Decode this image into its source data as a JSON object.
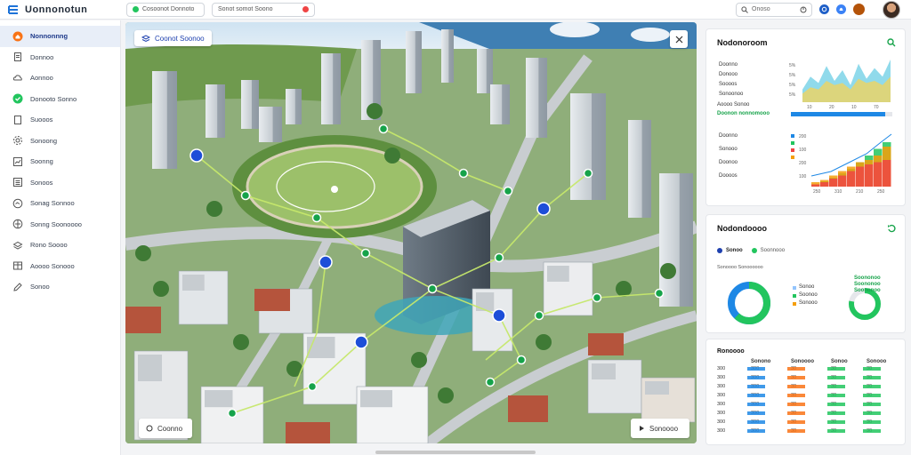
{
  "app": {
    "title": "Uonnonotun",
    "filter1": "Cosoonot Donnoto",
    "filter2": "Sonot somot Soono"
  },
  "search": {
    "value": "Onoso"
  },
  "sidebar": {
    "items": [
      {
        "label": "Nonnonnng",
        "icon": "home-icon"
      },
      {
        "label": "Donnoo",
        "icon": "doc-icon"
      },
      {
        "label": "Aonnoo",
        "icon": "cloud-icon"
      },
      {
        "label": "Donooto Sonno",
        "icon": "check-icon"
      },
      {
        "label": "Suooos",
        "icon": "page-icon"
      },
      {
        "label": "Sonoong",
        "icon": "gear-icon"
      },
      {
        "label": "Soonng",
        "icon": "chart-icon"
      },
      {
        "label": "Sonoos",
        "icon": "list-icon"
      },
      {
        "label": "Sonag Sonnoo",
        "icon": "calendar-icon"
      },
      {
        "label": "Sonng Soonoooo",
        "icon": "map-icon"
      },
      {
        "label": "Rono Soooo",
        "icon": "layers-icon"
      },
      {
        "label": "Aoooo Sonooo",
        "icon": "table-icon"
      },
      {
        "label": "Sonoo",
        "icon": "edit-icon"
      }
    ]
  },
  "map": {
    "badge": "Coonot Soonoo",
    "footer_left": "Coonno",
    "footer_right": "Sonoooo"
  },
  "panel1": {
    "title": "Nodonoroom",
    "labels_top": [
      "Doonno",
      "Donooo",
      "Soooos",
      "Sonoonoo"
    ],
    "highlight_label": "Aoooo Sonoo",
    "highlight_value": "Doonon nonnomooo",
    "labels_bottom": [
      "Doonno",
      "Sonooo",
      "Doonoo",
      "Doooos"
    ],
    "top_axis_values": [
      "5%",
      "5%",
      "5%",
      "5%"
    ],
    "top_xticks": [
      "10",
      "20",
      "10",
      "70"
    ],
    "bottom_axis_values": [
      "200",
      "100",
      "200",
      "100"
    ],
    "bottom_xticks": [
      "250",
      "310",
      "210",
      "250"
    ],
    "progress": 0.93,
    "colors": {
      "accent": "#1e88e5",
      "green": "#22c55e",
      "red": "#ef4444",
      "orange": "#f59e0b"
    }
  },
  "panel2": {
    "title": "Nodondoooo",
    "tab1": "Sonoo",
    "tab2": "Soonnooo",
    "subtitle": "Sonoooo Sonoooooo",
    "legend_left": [
      "Sonoo",
      "Soonoo",
      "Sonooo"
    ],
    "legend_right": [
      "Soononoo",
      "Soononoo",
      "Soononoo"
    ],
    "donut_left": 0.62,
    "donut_right": 0.78
  },
  "panel3": {
    "title": "Ronoooo",
    "headers": [
      "Sonono",
      "Sonoooo",
      "Sonoo",
      "Sonooo"
    ],
    "rows": [
      [
        "300",
        "300",
        "30",
        "30",
        "30"
      ],
      [
        "300",
        "300",
        "30",
        "30",
        "30"
      ],
      [
        "300",
        "300",
        "30",
        "30",
        "30"
      ],
      [
        "300",
        "300",
        "30",
        "30",
        "30"
      ],
      [
        "300",
        "300",
        "30",
        "30",
        "30"
      ],
      [
        "300",
        "300",
        "30",
        "30",
        "30"
      ],
      [
        "300",
        "300",
        "30",
        "30",
        "30"
      ],
      [
        "300",
        "300",
        "30",
        "30",
        "30"
      ]
    ]
  }
}
